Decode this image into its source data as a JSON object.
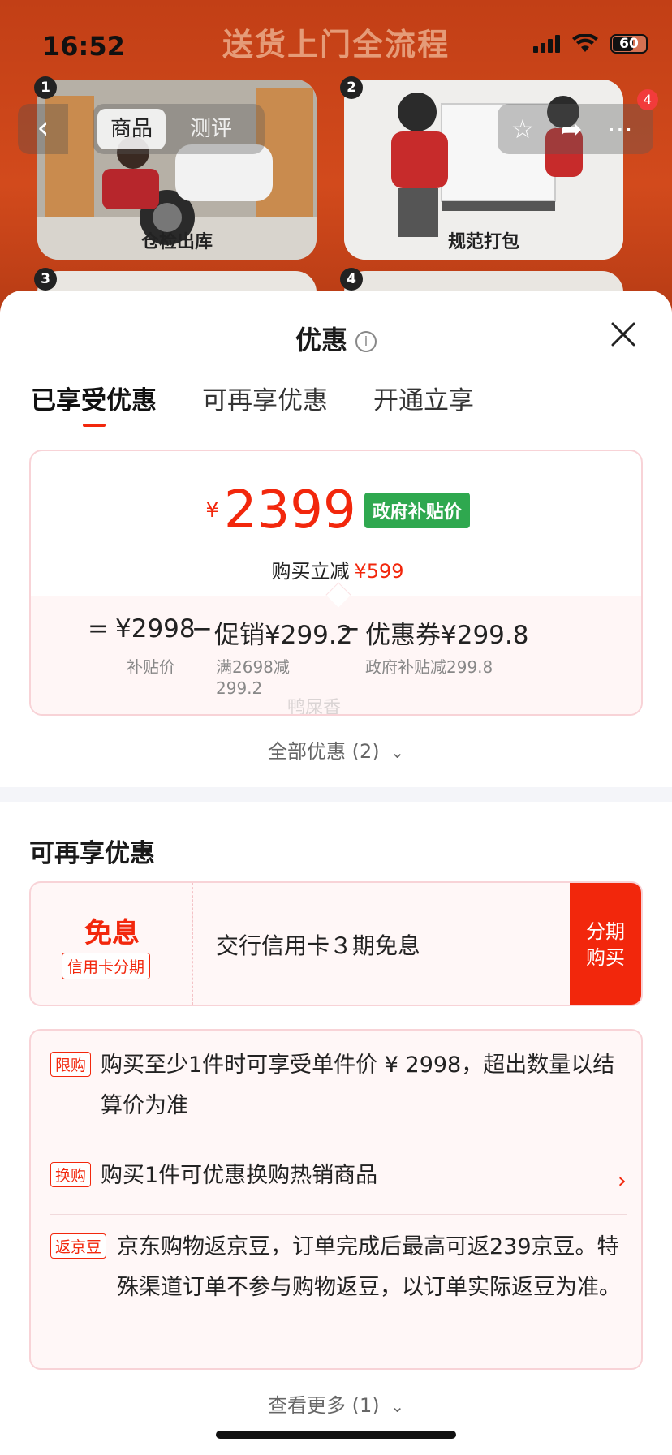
{
  "status_bar": {
    "time": "16:52",
    "battery": "60"
  },
  "banner": {
    "title": "送货上门全流程",
    "tiles": [
      {
        "num": "1",
        "label": "仓检出库"
      },
      {
        "num": "2",
        "label": "规范打包"
      },
      {
        "num": "3",
        "label": ""
      },
      {
        "num": "4",
        "label": ""
      }
    ]
  },
  "nav": {
    "tab_product": "商品",
    "tab_review": "测评",
    "badge_count": "4"
  },
  "sheet": {
    "title": "优惠",
    "tabs": [
      "已享受优惠",
      "可再享优惠",
      "开通立享"
    ],
    "price": {
      "currency": "¥",
      "amount": "2399",
      "badge": "政府补贴价",
      "reduce_label": "购买立减",
      "reduce_value": "¥599"
    },
    "breakdown": {
      "eq": "=",
      "base_price": "¥2998",
      "base_label": "补贴价",
      "minus1": "−",
      "promo": "促销¥299.2",
      "promo_desc_1": "满2698减",
      "promo_desc_2": "299.2",
      "minus2": "−",
      "coupon": "优惠券¥299.8",
      "coupon_desc": "政府补贴减299.8"
    },
    "watermark": "鸭屎香",
    "all_offers": "全部优惠 (2)",
    "section_title": "可再享优惠",
    "credit": {
      "headline": "免息",
      "tag": "信用卡分期",
      "text": "交行信用卡３期免息",
      "button_line1": "分期",
      "button_line2": "购买"
    },
    "rules": [
      {
        "tag": "限购",
        "text": "购买至少1件时可享受单件价 ¥ 2998，超出数量以结算价为准"
      },
      {
        "tag": "换购",
        "text": "购买1件可优惠换购热销商品"
      },
      {
        "tag": "返京豆",
        "text": "京东购物返京豆，订单完成后最高可返239京豆。特殊渠道订单不参与购物返豆，以订单实际返豆为准。"
      }
    ],
    "see_more": "查看更多 (1)"
  },
  "colors": {
    "accent": "#f2270c",
    "badge_green": "#2fa84f",
    "card_border": "#f8d3d7"
  }
}
